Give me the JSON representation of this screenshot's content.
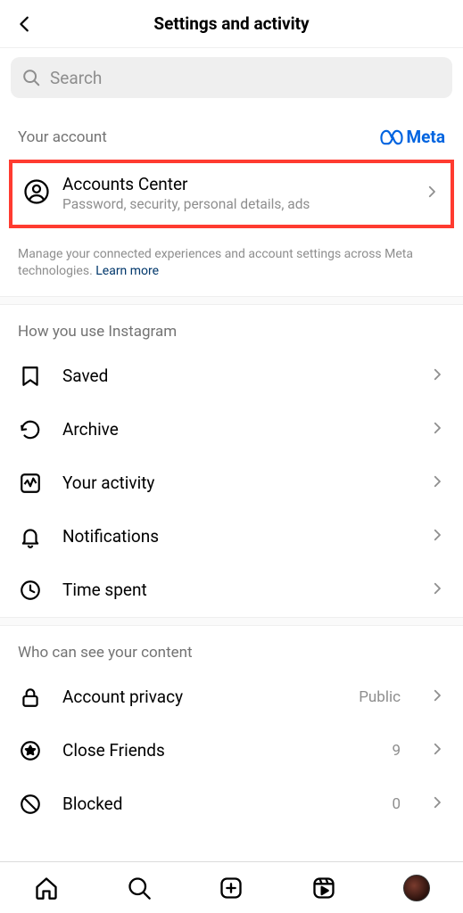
{
  "header": {
    "title": "Settings and activity"
  },
  "search": {
    "placeholder": "Search"
  },
  "account_section": {
    "label": "Your account",
    "brand": "Meta",
    "accounts_center": {
      "title": "Accounts Center",
      "subtitle": "Password, security, personal details, ads"
    },
    "footnote": "Manage your connected experiences and account settings across Meta technologies. ",
    "learn_more": "Learn more"
  },
  "usage_section": {
    "label": "How you use Instagram",
    "items": [
      {
        "id": "saved",
        "label": "Saved"
      },
      {
        "id": "archive",
        "label": "Archive"
      },
      {
        "id": "activity",
        "label": "Your activity"
      },
      {
        "id": "notifications",
        "label": "Notifications"
      },
      {
        "id": "timespent",
        "label": "Time spent"
      }
    ]
  },
  "visibility_section": {
    "label": "Who can see your content",
    "items": [
      {
        "id": "privacy",
        "label": "Account privacy",
        "value": "Public"
      },
      {
        "id": "closefriends",
        "label": "Close Friends",
        "value": "9"
      },
      {
        "id": "blocked",
        "label": "Blocked",
        "value": "0"
      }
    ]
  }
}
